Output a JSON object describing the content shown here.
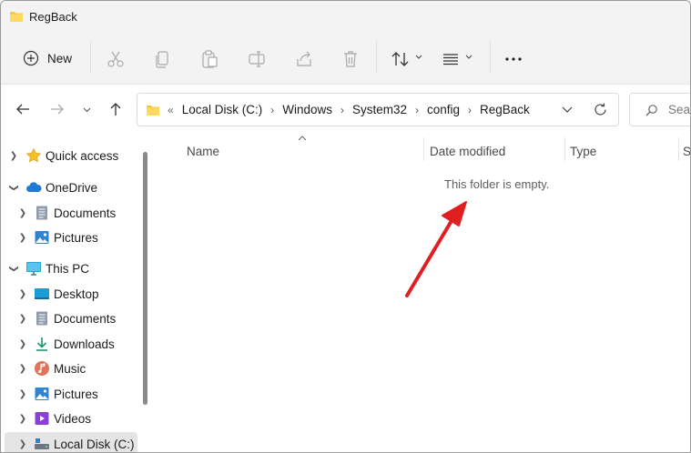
{
  "window": {
    "title": "RegBack"
  },
  "toolbar": {
    "new_label": "New"
  },
  "address": {
    "crumbs": [
      "Local Disk (C:)",
      "Windows",
      "System32",
      "config",
      "RegBack"
    ]
  },
  "search": {
    "placeholder": "Sear"
  },
  "sidebar": {
    "items": [
      {
        "label": "Quick access",
        "icon": "star-icon"
      },
      {
        "label": "OneDrive",
        "icon": "cloud-icon"
      },
      {
        "label": "Documents",
        "icon": "documents-icon"
      },
      {
        "label": "Pictures",
        "icon": "pictures-icon"
      },
      {
        "label": "This PC",
        "icon": "monitor-icon"
      },
      {
        "label": "Desktop",
        "icon": "desktop-icon"
      },
      {
        "label": "Documents",
        "icon": "documents-icon"
      },
      {
        "label": "Downloads",
        "icon": "download-icon"
      },
      {
        "label": "Music",
        "icon": "music-icon"
      },
      {
        "label": "Pictures",
        "icon": "pictures-icon"
      },
      {
        "label": "Videos",
        "icon": "videos-icon"
      },
      {
        "label": "Local Disk (C:)",
        "icon": "drive-icon"
      }
    ]
  },
  "columns": {
    "name": "Name",
    "date": "Date modified",
    "type": "Type",
    "size": "S"
  },
  "content": {
    "empty_message": "This folder is empty."
  },
  "colors": {
    "accent": "#0067c0",
    "folder": "#f8c63c",
    "annotation_arrow": "#e02020"
  }
}
